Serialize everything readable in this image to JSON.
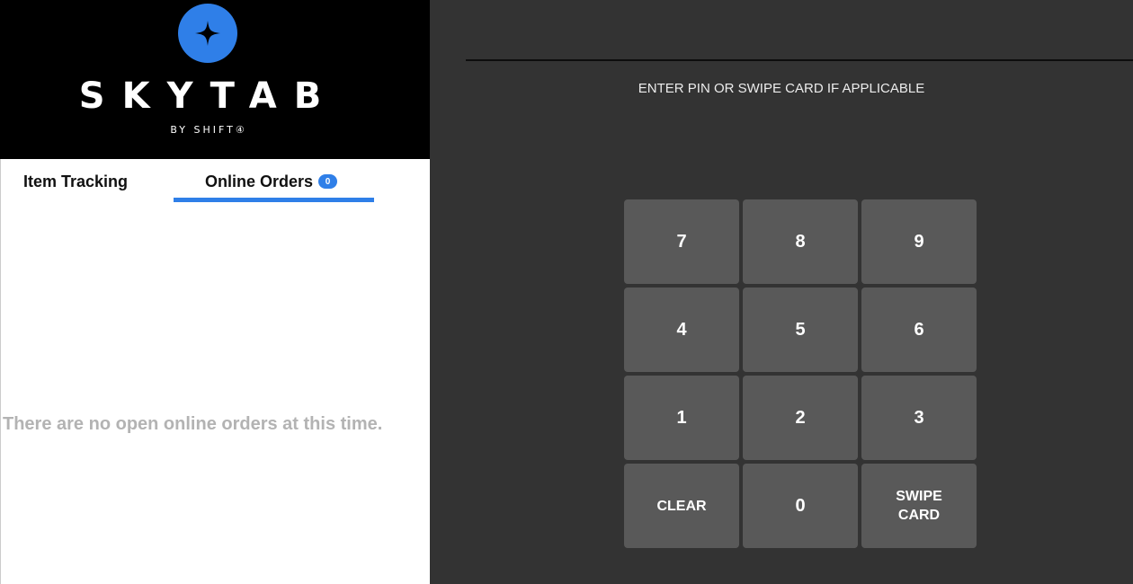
{
  "brand": {
    "name": "SKYTAB",
    "byline": "BY SHIFT④",
    "accent_color": "#2f7fe8",
    "logo_icon": "four-point-star-icon"
  },
  "tabs": [
    {
      "label": "Item Tracking",
      "active": false
    },
    {
      "label": "Online Orders",
      "active": true,
      "badge": "0"
    }
  ],
  "online_orders": {
    "empty_message": "There are no open online orders at this time."
  },
  "login": {
    "prompt": "ENTER PIN OR SWIPE CARD IF APPLICABLE",
    "keys": [
      "7",
      "8",
      "9",
      "4",
      "5",
      "6",
      "1",
      "2",
      "3",
      "CLEAR",
      "0",
      "SWIPE CARD"
    ]
  }
}
